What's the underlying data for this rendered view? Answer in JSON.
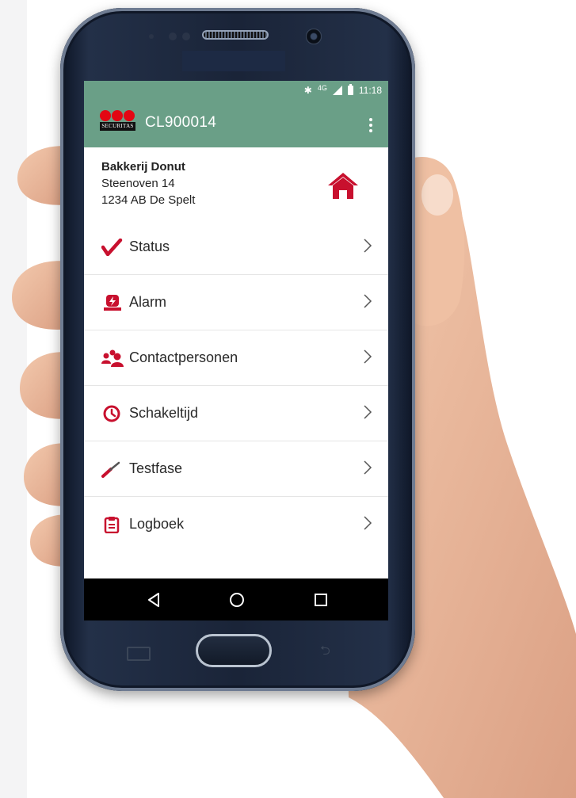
{
  "status_bar": {
    "bluetooth": "✱",
    "network": "4G",
    "time": "11:18"
  },
  "app_bar": {
    "logo_text": "SECURITAS",
    "title": "CL900014"
  },
  "location": {
    "name": "Bakkerij Donut",
    "street": "Steenoven 14",
    "postal_city": "1234 AB De Spelt"
  },
  "menu": [
    {
      "label": "Status",
      "icon": "checkmark-icon"
    },
    {
      "label": "Alarm",
      "icon": "alarm-light-icon"
    },
    {
      "label": "Contactpersonen",
      "icon": "contacts-icon"
    },
    {
      "label": "Schakeltijd",
      "icon": "clock-icon"
    },
    {
      "label": "Testfase",
      "icon": "screwdriver-icon"
    },
    {
      "label": "Logboek",
      "icon": "clipboard-icon"
    }
  ],
  "nav": {
    "back_icon": "back-triangle-icon",
    "home_icon": "home-circle-icon",
    "recents_icon": "recents-square-icon"
  },
  "colors": {
    "app_bar": "#6a9f87",
    "accent_red": "#c8102e",
    "brand_red": "#e30613"
  }
}
